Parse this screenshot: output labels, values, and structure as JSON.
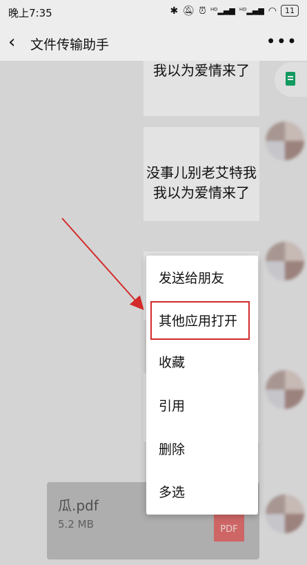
{
  "status_bar": {
    "time": "晚上7:35",
    "icons": [
      "bluetooth-icon",
      "mute-icon",
      "alarm-icon",
      "hd-signal-icon",
      "hd-signal-icon",
      "wifi-icon"
    ],
    "battery": "11"
  },
  "header": {
    "title": "文件传输助手"
  },
  "messages": [
    {
      "text": "我以为爱情来了"
    },
    {
      "text_line1": "没事儿别老艾特我",
      "text_line2": "我以为爱情来了"
    }
  ],
  "context_menu": {
    "items": [
      "发送给朋友",
      "其他应用打开",
      "收藏",
      "引用",
      "删除",
      "多选"
    ],
    "highlighted_index": 1
  },
  "file": {
    "name": "瓜.pdf",
    "size": "5.2 MB",
    "icon_label": "PDF"
  },
  "colors": {
    "highlight": "#d32a2a",
    "doc_green": "#14a86a"
  }
}
